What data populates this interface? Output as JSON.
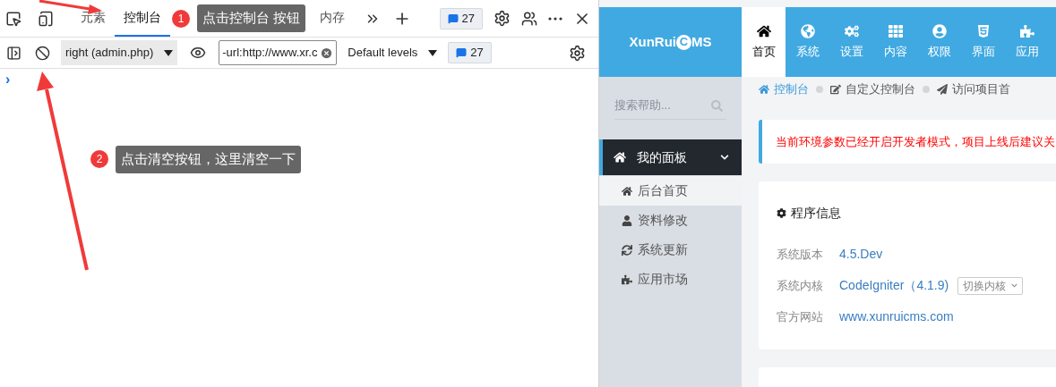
{
  "devtools": {
    "tabs": [
      {
        "label": "元素",
        "selected": false
      },
      {
        "label": "控制台",
        "selected": true
      },
      {
        "label": "内存",
        "selected": false
      }
    ],
    "tab_annotation": {
      "number": "1",
      "text": "点击控制台 按钮"
    },
    "issues_badge": "27",
    "console_toolbar": {
      "context": "right (admin.php)",
      "filter": "-url:http://www.xr.c",
      "levels": "Default levels",
      "issues_badge": "27"
    },
    "prompt": "›",
    "clear_annotation": {
      "number": "2",
      "text": "点击清空按钮，这里清空一下"
    }
  },
  "cms": {
    "logo": {
      "prefix": "XunRui",
      "mark": "C",
      "suffix": "MS"
    },
    "nav": [
      {
        "label": "首页",
        "selected": true
      },
      {
        "label": "系统",
        "selected": false
      },
      {
        "label": "设置",
        "selected": false
      },
      {
        "label": "内容",
        "selected": false
      },
      {
        "label": "权限",
        "selected": false
      },
      {
        "label": "界面",
        "selected": false
      },
      {
        "label": "应用",
        "selected": false
      }
    ],
    "search": {
      "placeholder": "搜索帮助..."
    },
    "sidebar": {
      "section": {
        "label": "我的面板",
        "expanded": true
      },
      "items": [
        {
          "label": "后台首页",
          "selected": true
        },
        {
          "label": "资料修改",
          "selected": false
        },
        {
          "label": "系统更新",
          "selected": false
        },
        {
          "label": "应用市场",
          "selected": false
        }
      ]
    },
    "breadcrumb": [
      "控制台",
      "自定义控制台",
      "访问项目首"
    ],
    "alert": "当前环境参数已经开启开发者模式，项目上线后建议关",
    "info_card": {
      "title": "程序信息",
      "rows": [
        {
          "label": "系统版本",
          "value": "4.5.Dev"
        },
        {
          "label": "系统内核",
          "value": "CodeIgniter（4.1.9)",
          "button": "切换内核"
        },
        {
          "label": "官方网站",
          "value": "www.xunruicms.com"
        }
      ]
    }
  }
}
